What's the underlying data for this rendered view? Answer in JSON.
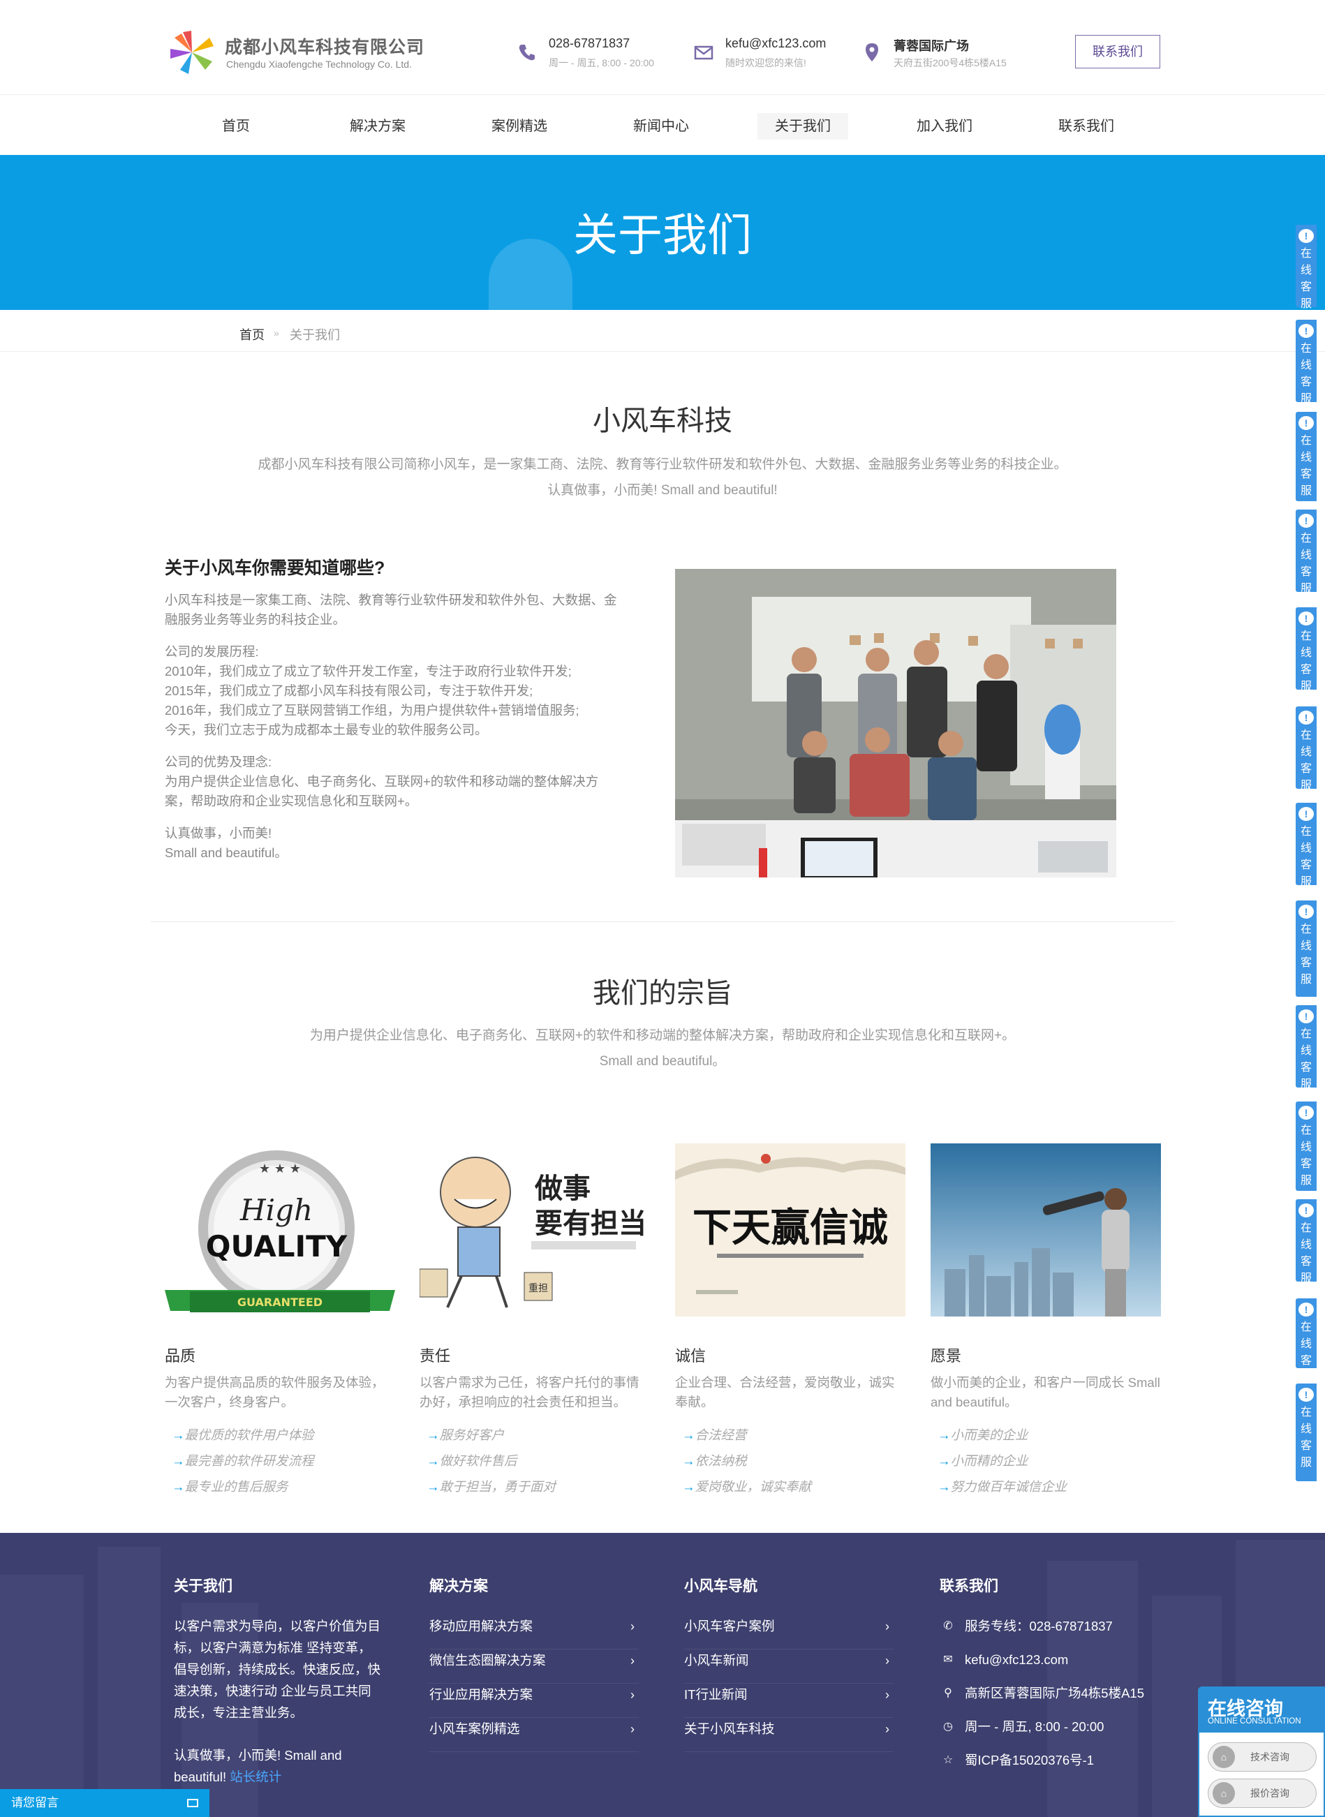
{
  "header": {
    "company_cn": "成都小风车科技有限公司",
    "company_en": "Chengdu Xiaofengche Technology Co. Ltd.",
    "phone": "028-67871837",
    "phone_hours": "周一 - 周五, 8:00 - 20:00",
    "email": "kefu@xfc123.com",
    "email_note": "随时欢迎您的来信!",
    "location": "菁蓉国际广场",
    "address": "天府五街200号4栋5楼A15",
    "contact_button": "联系我们"
  },
  "nav": {
    "items": [
      "首页",
      "解决方案",
      "案例精选",
      "新闻中心",
      "关于我们",
      "加入我们",
      "联系我们"
    ],
    "active": "关于我们"
  },
  "banner": {
    "title": "关于我们"
  },
  "breadcrumb": {
    "home": "首页",
    "sep": "»",
    "current": "关于我们"
  },
  "intro": {
    "title": "小风车科技",
    "line1": "成都小风车科技有限公司简称小风车，是一家集工商、法院、教育等行业软件研发和软件外包、大数据、金融服务业务等业务的科技企业。",
    "line2": "认真做事，小而美!   Small and beautiful!"
  },
  "about": {
    "heading": "关于小风车你需要知道哪些?",
    "p1": "小风车科技是一家集工商、法院、教育等行业软件研发和软件外包、大数据、金融服务业务等业务的科技企业。",
    "history_title": "公司的发展历程:",
    "history": [
      "2010年，我们成立了成立了软件开发工作室，专注于政府行业软件开发;",
      "2015年，我们成立了成都小风车科技有限公司，专注于软件开发;",
      "2016年，我们成立了互联网营销工作组，为用户提供软件+营销增值服务;",
      "今天，我们立志于成为成都本土最专业的软件服务公司。"
    ],
    "advantage_title": "公司的优势及理念:",
    "advantage": "为用户提供企业信息化、电子商务化、互联网+的软件和移动端的整体解决方案，帮助政府和企业实现信息化和互联网+。",
    "motto1": "认真做事，小而美!",
    "motto2": "Small and beautiful。"
  },
  "purpose": {
    "title": "我们的宗旨",
    "line1": "为用户提供企业信息化、电子商务化、互联网+的软件和移动端的整体解决方案，帮助政府和企业实现信息化和互联网+。",
    "line2": "Small and beautiful。"
  },
  "values": [
    {
      "title": "品质",
      "desc": "为客户提供高品质的软件服务及体验，一次客户，终身客户。",
      "image_text_1": "High",
      "image_text_2": "QUALITY",
      "image_text_3": "GUARANTEED",
      "points": [
        "最优质的软件用户体验",
        "最完善的软件研发流程",
        "最专业的售后服务"
      ]
    },
    {
      "title": "责任",
      "desc": "以客户需求为己任，将客户托付的事情办好，承担响应的社会责任和担当。",
      "image_text_1": "做事",
      "image_text_2": "要有担当",
      "image_text_3": "重担",
      "points": [
        "服务好客户",
        "做好软件售后",
        "敢于担当，勇于面对"
      ]
    },
    {
      "title": "诚信",
      "desc": "企业合理、合法经营，爱岗敬业，诚实奉献。",
      "image_text_1": "下天赢信诚",
      "points": [
        "合法经营",
        "依法纳税",
        "爱岗敬业，诚实奉献"
      ]
    },
    {
      "title": "愿景",
      "desc": "做小而美的企业，和客户一同成长 Small and beautiful。",
      "points": [
        "小而美的企业",
        "小而精的企业",
        "努力做百年诚信企业"
      ]
    }
  ],
  "arrow": "→",
  "footer": {
    "about_title": "关于我们",
    "about_text": "以客户需求为导向，以客户价值为目标，以客户满意为标准 坚持变革，倡导创新，持续成长。快速反应，快速决策，快速行动 企业与员工共同成长，专注主营业务。",
    "about_motto": "认真做事，小而美!   Small and beautiful!",
    "stats_link": "站长统计",
    "solutions_title": "解决方案",
    "solutions": [
      "移动应用解决方案",
      "微信生态圈解决方案",
      "行业应用解决方案",
      "小风车案例精选"
    ],
    "nav_title": "小风车导航",
    "nav_links": [
      "小风车客户案例",
      "小风车新闻",
      "IT行业新闻",
      "关于小风车科技"
    ],
    "contact_title": "联系我们",
    "contacts": [
      {
        "icon": "phone-icon",
        "text": "服务专线：028-67871837"
      },
      {
        "icon": "mail-icon",
        "text": "kefu@xfc123.com"
      },
      {
        "icon": "location-icon",
        "text": "高新区菁蓉国际广场4栋5楼A15"
      },
      {
        "icon": "clock-icon",
        "text": "周一 - 周五, 8:00 - 20:00"
      },
      {
        "icon": "star-icon",
        "text": "蜀ICP备15020376号-1"
      }
    ]
  },
  "side_service": {
    "label_chars": [
      "在",
      "线",
      "客",
      "服"
    ],
    "tab_count": 13
  },
  "message_bar": {
    "label": "请您留言"
  },
  "consult": {
    "title": "在线咨询",
    "subtitle": "ONLINE CONSULTATION",
    "buttons": [
      "技术咨询",
      "报价咨询"
    ]
  },
  "colors": {
    "primary_blue": "#0a9de4",
    "footer_bg": "#3d3f6e",
    "accent_purple": "#7a6aa8"
  }
}
